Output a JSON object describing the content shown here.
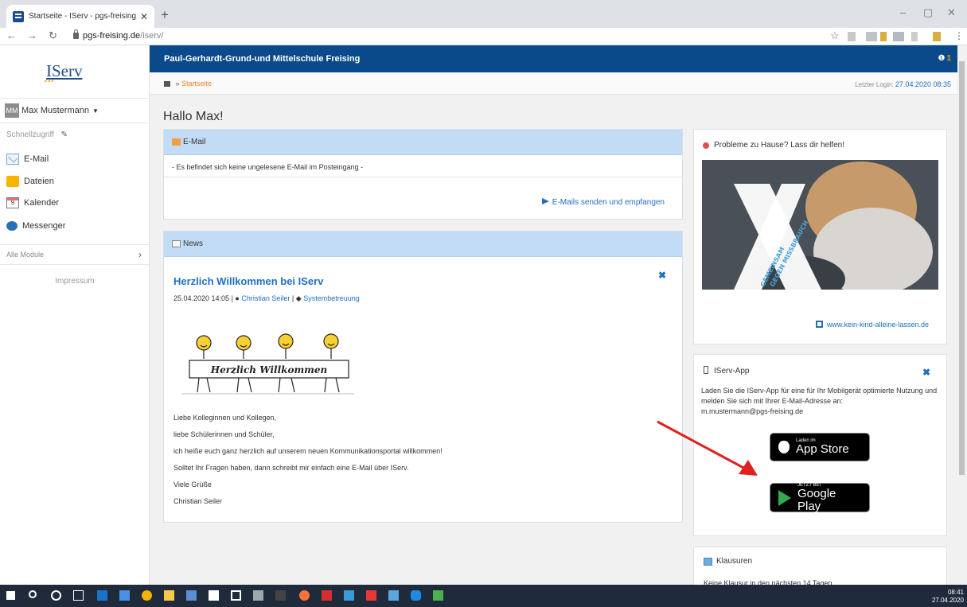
{
  "browser": {
    "tab_title": "Startseite - IServ - pgs-freising.de",
    "tab_close": "✕",
    "new_tab": "+",
    "url_host": "pgs-freising.de",
    "url_path": "/iserv/"
  },
  "sidebar": {
    "logo": "IServ",
    "user": {
      "initials": "MM",
      "name": "Max Mustermann"
    },
    "quick_access": "Schnellzugriff",
    "items": [
      {
        "label": "E-Mail",
        "icon": "mail-icon"
      },
      {
        "label": "Dateien",
        "icon": "folder-icon"
      },
      {
        "label": "Kalender",
        "icon": "calendar-icon",
        "day": "9"
      },
      {
        "label": "Messenger",
        "icon": "messenger-icon"
      }
    ],
    "all_modules": "Alle Module",
    "impressum": "Impressum"
  },
  "header": {
    "school": "Paul-Gerhardt-Grund-und Mittelschule Freising",
    "notification_count": "1"
  },
  "breadcrumb": {
    "separator": "»",
    "current": "Startseite"
  },
  "last_login": {
    "label": "Letzter Login:",
    "date": "27.04.2020 08:35"
  },
  "greeting": "Hallo Max!",
  "email_panel": {
    "title": "E-Mail",
    "empty_text": "- Es befindet sich keine ungelesene E-Mail im Posteingang -",
    "link": "E-Mails senden und empfangen"
  },
  "news_panel": {
    "title": "News",
    "post_title": "Herzlich Willkommen bei IServ",
    "datetime": "25.04.2020 14:05",
    "author": "Christian Seiler",
    "category": "Systembetreuung",
    "image_text": "Herzlich Willkommen",
    "body": [
      "Liebe Kolleginnen und Kollegen,",
      "liebe Schülerinnen und Schüler,",
      "ich heiße euch ganz herzlich auf unserem neuen Kommunikationsportal willkommen!",
      "Solltet Ihr Fragen haben, dann schreibt mir einfach eine E-Mail über IServ.",
      "Viele Grüße",
      "Christian Seiler"
    ]
  },
  "help_panel": {
    "title": "Probleme zu Hause? Lass dir helfen!",
    "image_text_1": "GEMEINSAM",
    "image_text_2": "GEGEN MISSBRAUCH",
    "link": "www.kein-kind-alleine-lassen.de"
  },
  "app_panel": {
    "title": "IServ-App",
    "description": "Laden Sie die IServ-App für eine für Ihr Mobilgerät optimierte Nutzung und melden Sie sich mit Ihrer E-Mail-Adresse an:",
    "email": "m.mustermann@pgs-freising.de",
    "appstore_small": "Laden im",
    "appstore_big": "App Store",
    "play_small": "JETZT BEI",
    "play_big": "Google Play"
  },
  "exam_panel": {
    "title": "Klausuren",
    "text": "Keine Klausur in den nächsten 14 Tagen."
  },
  "taskbar": {
    "time": "08:41",
    "date": "27.04.2020"
  },
  "colors": {
    "header": "#0b4a8a",
    "panel_head": "#c3dcf6",
    "link": "#1f6fc2",
    "accent": "#f0842e"
  }
}
